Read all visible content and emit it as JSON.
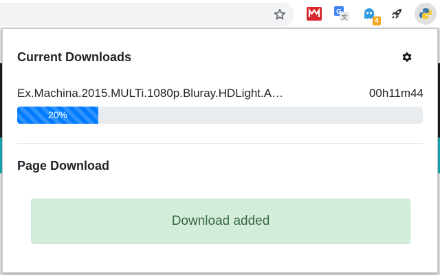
{
  "toolbar": {
    "extensions": [
      {
        "icon": "mega-icon",
        "color": "#d9272e"
      },
      {
        "icon": "google-translate-icon",
        "color": "#4285f4"
      },
      {
        "icon": "ghost-icon",
        "color": "#2f9be0",
        "badge": "4"
      },
      {
        "icon": "rocket-icon",
        "color": "#333333"
      },
      {
        "icon": "python-icon",
        "color": "#3b77a8"
      }
    ]
  },
  "popup": {
    "current_downloads": {
      "title": "Current Downloads",
      "items": [
        {
          "filename": "Ex.Machina.2015.MULTi.1080p.Bluray.HDLight.A…",
          "time_left": "00h11m44",
          "progress_label": "20%",
          "progress": 0.2
        }
      ]
    },
    "page_download": {
      "title": "Page Download",
      "status": "Download added"
    }
  },
  "colors": {
    "progress": "#007bff",
    "success_bg": "#d4edda",
    "success_text": "#356b3f"
  }
}
